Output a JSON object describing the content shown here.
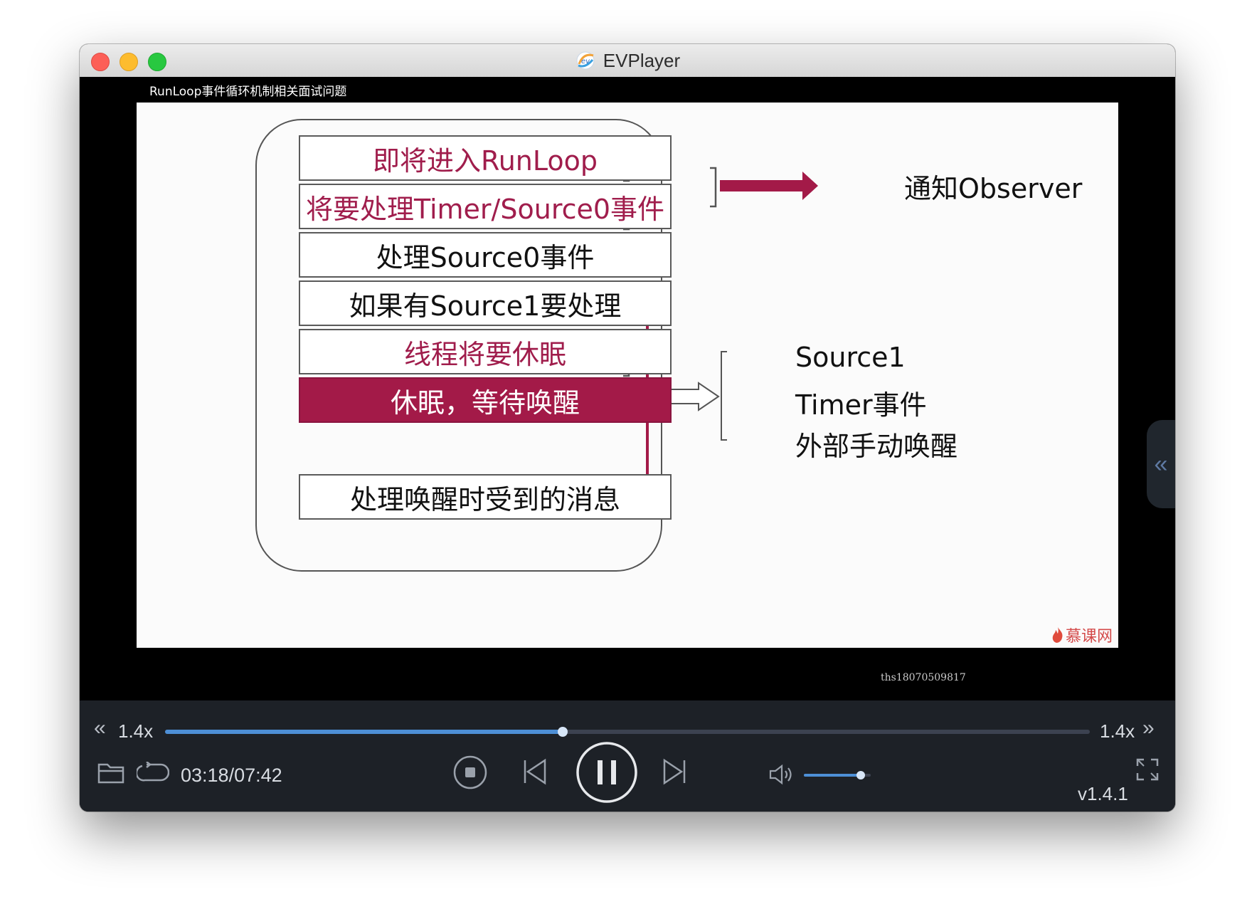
{
  "window": {
    "title": "EVPlayer",
    "app_icon": "evplayer-logo-icon"
  },
  "video": {
    "title": "RunLoop事件循环机制相关面试问题",
    "watermark": "ths18070509817",
    "playback_progress": 0.42,
    "slide": {
      "boxes": [
        {
          "label": "即将进入RunLoop",
          "style": "red-text"
        },
        {
          "label": "将要处理Timer/Source0事件",
          "style": "red-text"
        },
        {
          "label": "处理Source0事件",
          "style": "plain"
        },
        {
          "label": "如果有Source1要处理",
          "style": "plain"
        },
        {
          "label": "线程将要休眠",
          "style": "red-text"
        },
        {
          "label": "休眠，等待唤醒",
          "style": "filled"
        },
        {
          "label": "处理唤醒时受到的消息",
          "style": "plain"
        }
      ],
      "notify_label": "通知Observer",
      "wake_sources": [
        "Source1",
        "Timer事件",
        "外部手动唤醒"
      ],
      "logo_text": "慕课网",
      "accent_color": "#a31a48"
    }
  },
  "controls": {
    "speed_left": "1.4x",
    "speed_right": "1.4x",
    "seek_progress": 0.43,
    "time": "03:18/07:42",
    "volume_level": 0.85,
    "version": "v1.4.1",
    "icons": {
      "speed_down": "double-chevron-left-icon",
      "speed_up": "double-chevron-right-icon",
      "open": "folder-icon",
      "loop": "loop-icon",
      "stop": "stop-icon",
      "prev": "previous-icon",
      "play_pause": "pause-icon",
      "next": "next-icon",
      "volume": "volume-icon",
      "fullscreen": "fullscreen-icon",
      "side_panel": "side-panel-toggle-icon"
    },
    "accent_color": "#4d8fd6"
  }
}
